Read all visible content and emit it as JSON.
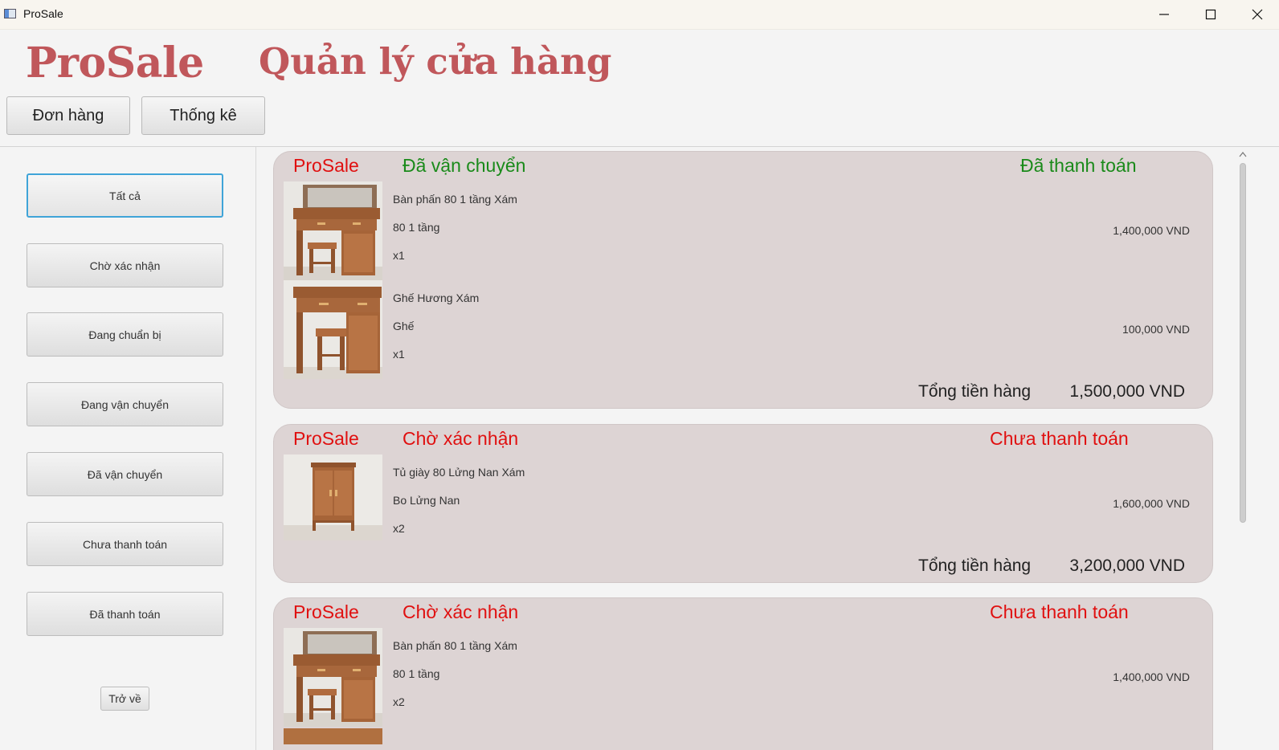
{
  "window": {
    "title": "ProSale"
  },
  "header": {
    "brand": "ProSale",
    "headline": "Quản lý cửa hàng"
  },
  "nav": {
    "orders_label": "Đơn hàng",
    "stats_label": "Thống kê"
  },
  "sidebar": {
    "items": [
      {
        "label": "Tất cả",
        "active": true
      },
      {
        "label": "Chờ xác nhận"
      },
      {
        "label": "Đang chuẩn bị"
      },
      {
        "label": "Đang vận chuyển"
      },
      {
        "label": "Đã vận chuyển"
      },
      {
        "label": "Chưa thanh toán"
      },
      {
        "label": "Đã thanh toán"
      }
    ],
    "back_label": "Trở về"
  },
  "colors": {
    "brand": "#c0575b",
    "success": "#1a8a1a",
    "danger": "#e01010",
    "card_bg": "#ddd4d4",
    "focus": "#3fa4d8"
  },
  "orders": [
    {
      "shop": "ProSale",
      "shipping_status": "Đã vận chuyển",
      "payment_status": "Đã thanh toán",
      "items": [
        {
          "name": "Bàn phấn 80 1 tầng Xám",
          "variant": "80 1 tầng",
          "qty": "x1",
          "price": "1,400,000  VND",
          "image": "dresser-icon"
        },
        {
          "name": "Ghế Hương Xám",
          "variant": "Ghế",
          "qty": "x1",
          "price": "100,000  VND",
          "image": "dresser-icon"
        }
      ],
      "total_label": "Tổng tiền hàng",
      "total_value": "1,500,000 VND"
    },
    {
      "shop": "ProSale",
      "shipping_status": "Chờ xác nhận",
      "payment_status": "Chưa thanh toán",
      "items": [
        {
          "name": "Tủ giày 80 Lửng Nan Xám",
          "variant": "Bo Lửng Nan",
          "qty": "x2",
          "price": "1,600,000  VND",
          "image": "cabinet-icon"
        }
      ],
      "total_label": "Tổng tiền hàng",
      "total_value": "3,200,000 VND"
    },
    {
      "shop": "ProSale",
      "shipping_status": "Chờ xác nhận",
      "payment_status": "Chưa thanh toán",
      "items": [
        {
          "name": "Bàn phấn 80 1 tầng Xám",
          "variant": "80 1 tầng",
          "qty": "x2",
          "price": "1,400,000  VND",
          "image": "dresser-icon"
        }
      ]
    }
  ]
}
